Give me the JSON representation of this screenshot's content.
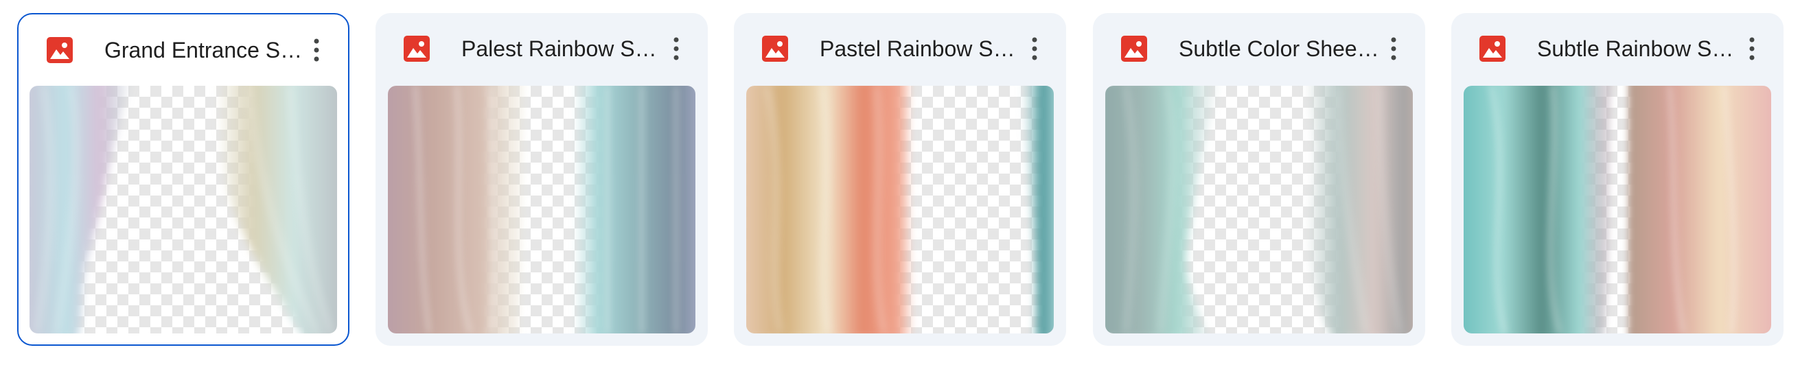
{
  "cards": [
    {
      "title": "Grand Entrance Sheer Curtains",
      "selected": true,
      "file_icon": "image-file-icon",
      "menu_icon": "more-vert-icon",
      "thumbnail": {
        "left_drape": [
          "#c9c7d8",
          "#bfe0e6",
          "#d6c2d8",
          "#a9b9c6"
        ],
        "right_drape": [
          "#d9d3b8",
          "#cfe5e2",
          "#b9c0c4",
          "#a8c9c4"
        ]
      }
    },
    {
      "title": "Palest Rainbow Sheer Curtains",
      "selected": false,
      "file_icon": "image-file-icon",
      "menu_icon": "more-vert-icon",
      "thumbnail": {
        "left_drape": [
          "#c7a9a0",
          "#d8c0b4",
          "#b99ea8",
          "#e9e4cf"
        ],
        "right_drape": [
          "#a9d7d8",
          "#8fb3b9",
          "#7d8fa0",
          "#a7acc7"
        ]
      }
    },
    {
      "title": "Pastel Rainbow Sheer Curtains",
      "selected": false,
      "file_icon": "image-file-icon",
      "menu_icon": "more-vert-icon",
      "thumbnail": {
        "left_drape": [
          "#e8cbb4",
          "#d4b07c",
          "#e58a6e",
          "#f0a38c"
        ],
        "right_drape": [
          "#4f9a9c",
          "#b8dde0"
        ]
      }
    },
    {
      "title": "Subtle Color Sheer Curtains",
      "selected": false,
      "file_icon": "image-file-icon",
      "menu_icon": "more-vert-icon",
      "thumbnail": {
        "left_drape": [
          "#9fb7b4",
          "#a9d9d0",
          "#c9d3d3",
          "#8fa9a8"
        ],
        "right_drape": [
          "#b6c7c4",
          "#d8c8c4",
          "#a5a5a5",
          "#c7b3ad"
        ]
      }
    },
    {
      "title": "Subtle Rainbow Sheer Curtains",
      "selected": false,
      "file_icon": "image-file-icon",
      "menu_icon": "more-vert-icon",
      "thumbnail": {
        "left_drape": [
          "#6bbfbd",
          "#9fd8d3",
          "#5a8f88",
          "#b69aa8"
        ],
        "right_drape": [
          "#d9a59b",
          "#f2ddbf",
          "#e8b4b4",
          "#b69d8d"
        ]
      }
    }
  ],
  "colors": {
    "selected_border": "#0b57d0",
    "card_bg": "#f0f4f9",
    "image_icon": "#e3382b",
    "title_text": "#1f1f1f",
    "menu_icon": "#444746"
  }
}
